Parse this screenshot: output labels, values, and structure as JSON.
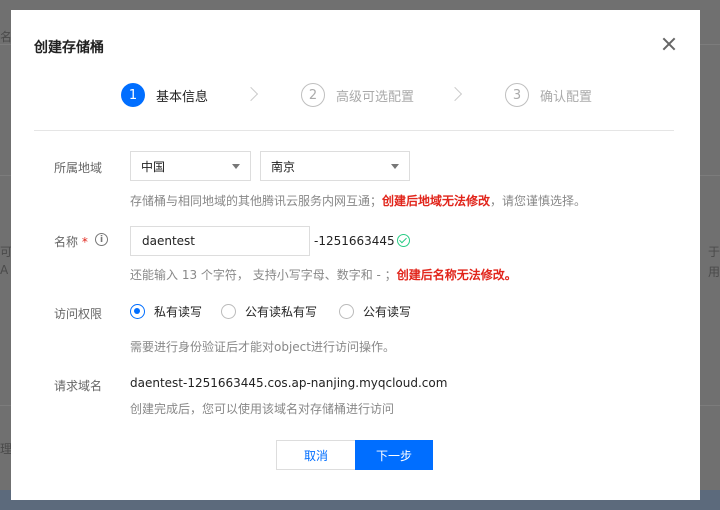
{
  "modal": {
    "title": "创建存储桶"
  },
  "steps": [
    {
      "num": "1",
      "label": "基本信息"
    },
    {
      "num": "2",
      "label": "高级可选配置"
    },
    {
      "num": "3",
      "label": "确认配置"
    }
  ],
  "region": {
    "label": "所属地域",
    "country": "中国",
    "city": "南京",
    "hint_normal": "存储桶与相同地域的其他腾讯云服务内网互通；",
    "hint_warn": "创建后地域无法修改",
    "hint_tail": "，请您谨慎选择。"
  },
  "name": {
    "label": "名称",
    "required_mark": "*",
    "info_icon": "i",
    "value": "daentest",
    "suffix": "-1251663445",
    "hint_normal": "还能输入 13 个字符， 支持小写字母、数字和 - ；",
    "hint_warn": "创建后名称无法修改。"
  },
  "access": {
    "label": "访问权限",
    "options": [
      "私有读写",
      "公有读私有写",
      "公有读写"
    ],
    "selected": "私有读写",
    "hint": "需要进行身份验证后才能对object进行访问操作。"
  },
  "domain": {
    "label": "请求域名",
    "value": "daentest-1251663445.cos.ap-nanjing.myqcloud.com",
    "hint": "创建完成后，您可以使用该域名对存储桶进行访问"
  },
  "buttons": {
    "cancel": "取消",
    "next": "下一步"
  },
  "background": {
    "edge_texts": [
      "名",
      "可",
      "A",
      "理",
      "于",
      "用"
    ]
  }
}
